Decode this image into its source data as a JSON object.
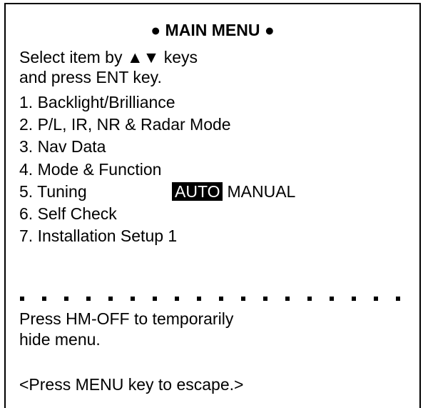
{
  "menu": {
    "title": "● MAIN MENU ●",
    "instructions": [
      "Select item by ▲▼ keys",
      "and press ENT key."
    ],
    "items": [
      "1. Backlight/Brilliance",
      "2. P/L, IR, NR & Radar Mode",
      "3. Nav Data",
      "4. Mode & Function",
      "5. Tuning",
      "6. Self Check",
      "7. Installation Setup 1"
    ],
    "tuning_options": {
      "selected": "AUTO",
      "other": "MANUAL"
    },
    "footer": {
      "hint_line1": "Press HM-OFF to temporarily",
      "hint_line2": "hide menu.",
      "escape": "<Press MENU key to escape.>"
    }
  },
  "colors": {
    "background": "#ffffff",
    "text": "#000000",
    "highlight_bg": "#000000",
    "highlight_text": "#ffffff"
  }
}
